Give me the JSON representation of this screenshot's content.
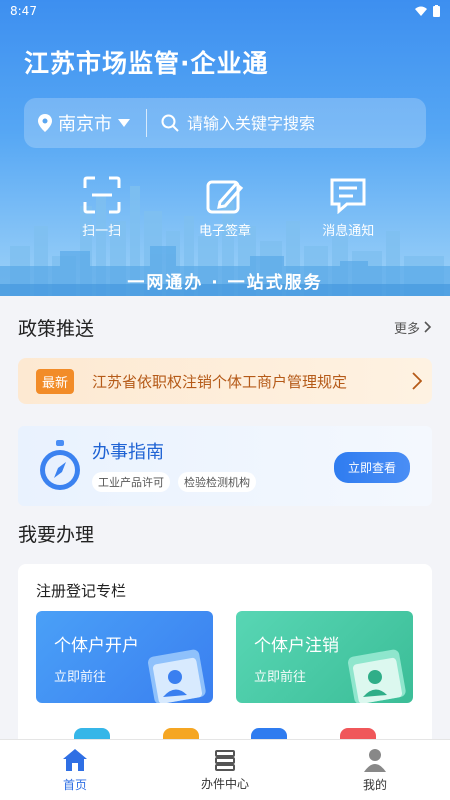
{
  "status": {
    "time": "8:47"
  },
  "header": {
    "title": "江苏市场监管·企业通",
    "city": "南京市",
    "search_placeholder": "请输入关键字搜索"
  },
  "quick_actions": [
    {
      "label": "扫一扫",
      "icon": "scan-icon"
    },
    {
      "label": "电子签章",
      "icon": "e-signature-icon"
    },
    {
      "label": "消息通知",
      "icon": "message-icon"
    }
  ],
  "slogan": "一网通办 · 一站式服务",
  "policy": {
    "title": "政策推送",
    "more_label": "更多",
    "badge": "最新",
    "notice": "江苏省依职权注销个体工商户管理规定"
  },
  "guide": {
    "title": "办事指南",
    "tags": [
      "工业产品许可",
      "检验检测机构"
    ],
    "button": "立即查看"
  },
  "handle": {
    "title": "我要办理",
    "card_title": "注册登记专栏",
    "tiles": [
      {
        "title": "个体户开户",
        "sub": "立即前往",
        "color": "#3a7ff0"
      },
      {
        "title": "个体户注销",
        "sub": "立即前往",
        "color": "#3bbd97"
      }
    ],
    "mini_colors": [
      "#36b6e8",
      "#f5a623",
      "#2f7cf0",
      "#f0575a"
    ]
  },
  "nav": {
    "items": [
      {
        "label": "首页",
        "icon": "home-icon",
        "active": true
      },
      {
        "label": "办件中心",
        "icon": "list-icon",
        "active": false
      },
      {
        "label": "我的",
        "icon": "user-icon",
        "active": false
      }
    ]
  },
  "colors": {
    "accent": "#2f6fe4",
    "hero": "#3d8ff0",
    "notice_bg": "#fde9d2",
    "badge": "#f28c28"
  }
}
